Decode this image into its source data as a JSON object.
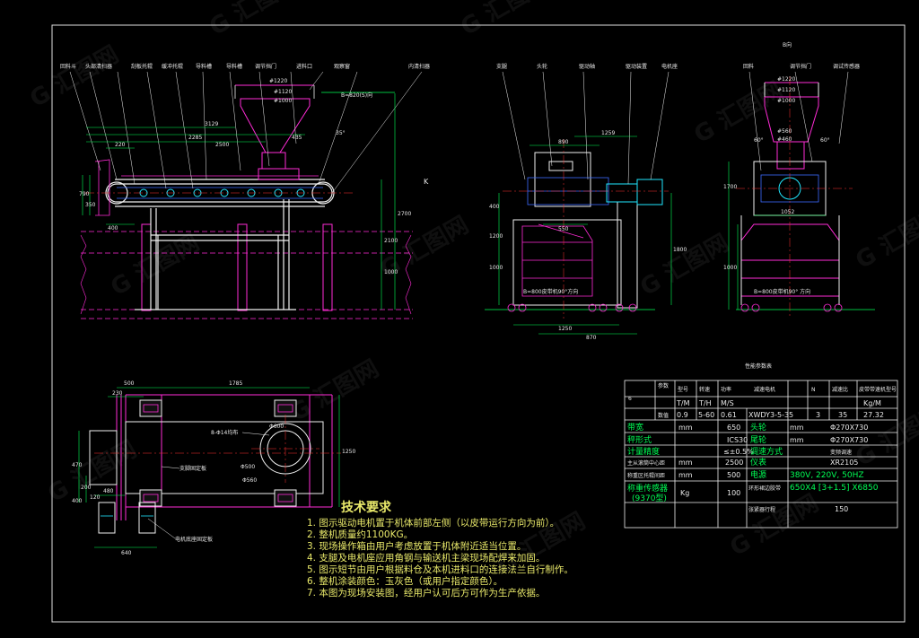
{
  "drawing": {
    "side_view_labels": [
      "回料斗",
      "头部清扫器",
      "刮板托辊",
      "缓冲托辊",
      "导料槽",
      "导料槽",
      "调节挡门",
      "进料口",
      "观察窗",
      "内清扫器"
    ],
    "side_dims": {
      "d1220": "#1220",
      "d1120": "#1120",
      "d1000": "#1000",
      "chute": "B=820(S)向",
      "len3129": "3129",
      "len2285": "2285",
      "len2500": "2500",
      "len220": "220",
      "len435": "435",
      "len400": "400",
      "h790": "790",
      "h350": "350",
      "h2700": "2700",
      "h2100": "2100",
      "h1000": "1000",
      "k": "K",
      "ang": "35°"
    },
    "front_view_labels": [
      "支腿",
      "头轮",
      "驱动轴",
      "驱动装置",
      "电机座"
    ],
    "front_dims": {
      "w890": "890",
      "w1250": "1250",
      "w870": "870",
      "w550": "550",
      "w1259": "1259",
      "h400": "400",
      "h1000": "1000",
      "h1800": "1800",
      "h1200": "1200",
      "note": "B=800皮带机90°方向"
    },
    "view_b_title": "B向",
    "view_b_labels": [
      "回料",
      "调节挡门",
      "调试传感器"
    ],
    "view_b_dims": {
      "d1220": "#1220",
      "d1120": "#1120",
      "d1000": "#1000",
      "d560": "#560",
      "d460": "#460",
      "w1052": "1052",
      "h1700": "1700",
      "h1000": "1000",
      "ang1": "60°",
      "ang2": "60°",
      "note": "B=800皮带机90° 方向"
    },
    "plan_dims": {
      "w500": "500",
      "w1785": "1785",
      "w230": "230",
      "w640": "640",
      "h1250": "1250",
      "h470": "470",
      "h200": "200",
      "h400": "400",
      "h120": "120",
      "w480": "480",
      "bolts": "8-Φ14均布",
      "d600": "Φ600",
      "d500": "Φ500",
      "d560": "Φ560"
    },
    "plan_labels": [
      "支脚固定板",
      "电机底座固定板"
    ],
    "table_title": "性能参数表",
    "table": {
      "r1": [
        "参数",
        "型号",
        "转速",
        "功率",
        "减速电机",
        "N",
        "减速比",
        "皮带带速机型号",
        "Kg/M"
      ],
      "r2": [
        "6",
        "数值",
        "T/M",
        "T/H",
        "M/S",
        "",
        "",
        "",
        ""
      ],
      "r3": [
        "",
        "",
        "0.9",
        "5-60",
        "0.61",
        "XWDY3-5-35",
        "3",
        "35",
        "27.32"
      ],
      "r4": [
        "带宽",
        "mm",
        "650",
        "头轮",
        "mm",
        "滚筒工作长",
        "Φ270X730"
      ],
      "r5": [
        "秤形式",
        "",
        "ICS30",
        "尾轮",
        "mm",
        "调偏滚筒长",
        "Φ270X730"
      ],
      "r6": [
        "计量精度",
        "",
        "≤±0.5%",
        "调速方式",
        "",
        "变频调速"
      ],
      "r7": [
        "主从滚筒中心距",
        "mm",
        "2500",
        "仪表",
        "",
        "XR2105"
      ],
      "r8": [
        "称重区托辊间距",
        "mm",
        "500",
        "电源",
        "",
        "380V, 220V, 50HZ"
      ],
      "r9": [
        "称重传感器",
        "Kg",
        "100",
        "环形裙边胶带",
        "",
        "650X4 [3+1.5] X6850"
      ],
      "r10": [
        "(9370型)",
        "",
        "",
        "张紧器行程",
        "",
        "150"
      ]
    },
    "requirements_title": "技术要求",
    "requirements": [
      "1.  图示驱动电机置于机体前部左侧（以皮带运行方向为前）。",
      "2.  整机质量约1100KG。",
      "3.  现场操作箱由用户考虑放置于机体附近适当位置。",
      "4.  支腿及电机座应用角钢与输送机主梁现场配焊来加固。",
      "5.  图示短节由用户根据料仓及本机进料口的连接法兰自行制作。",
      "6.  整机涂装颜色：玉灰色（或用户指定颜色）。",
      "7.  本图为现场安装图，经用户认可后方可作为生产依据。"
    ],
    "watermark": "G 汇图网"
  },
  "colors": {
    "bg": "#000000",
    "frame": "#e0e0e0",
    "magenta": "#ff2bd6",
    "blue": "#3b6bff",
    "cyan": "#21e7ff",
    "yellow": "#e9e96a",
    "green": "#00ff55",
    "red": "#ff3030",
    "white": "#f0f0f0"
  }
}
